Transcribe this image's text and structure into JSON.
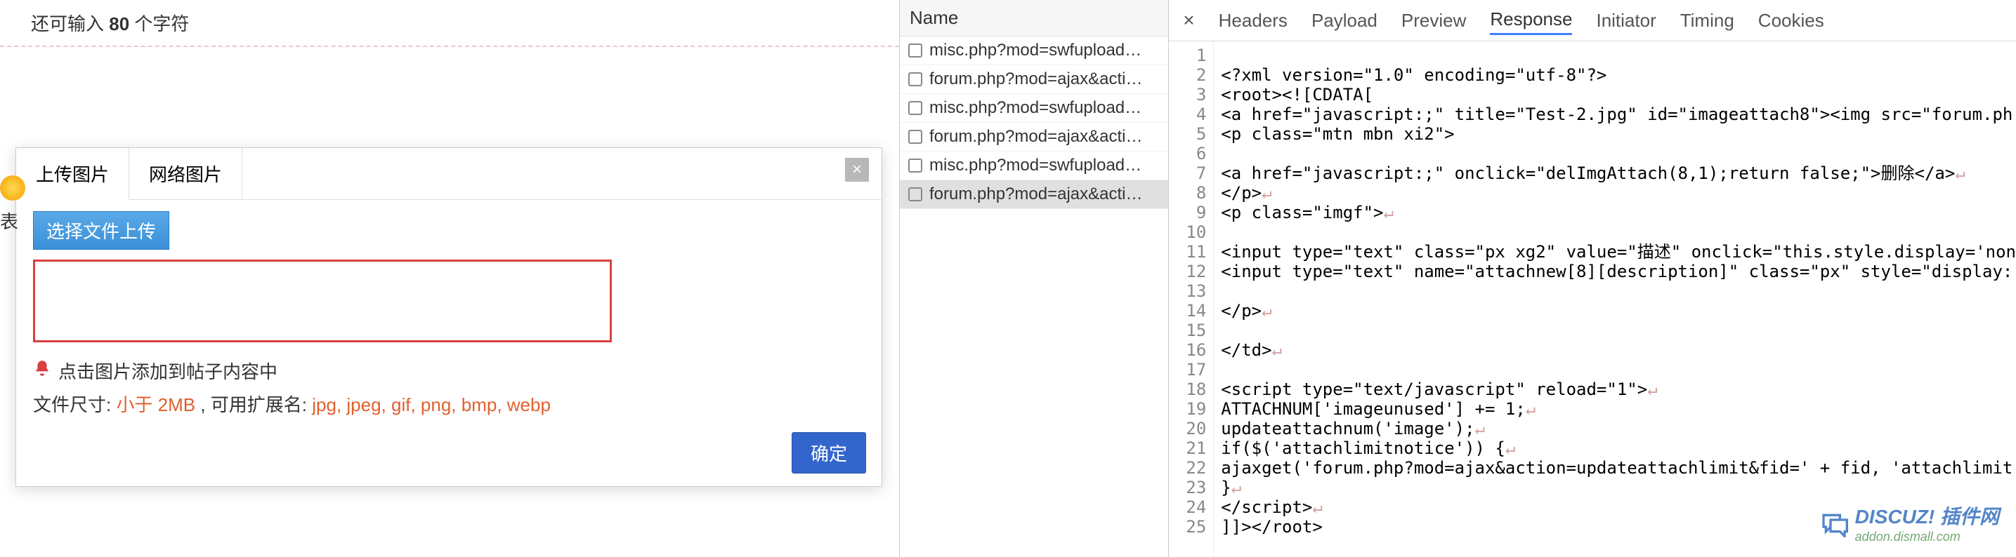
{
  "editor": {
    "char_counter_prefix": "还可输入 ",
    "char_count": "80",
    "char_counter_suffix": " 个字符",
    "side_label": "表"
  },
  "dialog": {
    "tabs": [
      "上传图片",
      "网络图片"
    ],
    "close_label": "×",
    "select_button": "选择文件上传",
    "hint": "点击图片添加到帖子内容中",
    "file_size_label": "文件尺寸: ",
    "file_size_value": "小于 2MB",
    "ext_label": " , 可用扩展名: ",
    "ext_value": "jpg, jpeg, gif, png, bmp, webp",
    "confirm": "确定"
  },
  "devtools": {
    "name_header": "Name",
    "requests": [
      "misc.php?mod=swfupload…",
      "forum.php?mod=ajax&acti…",
      "misc.php?mod=swfupload…",
      "forum.php?mod=ajax&acti…",
      "misc.php?mod=swfupload…",
      "forum.php?mod=ajax&acti…"
    ],
    "selected_index": 5,
    "tabs": [
      "Headers",
      "Payload",
      "Preview",
      "Response",
      "Initiator",
      "Timing",
      "Cookies"
    ],
    "active_tab": "Response",
    "close_icon": "×",
    "code": [
      "",
      "<?xml version=\"1.0\" encoding=\"utf-8\"?>",
      "<root><![CDATA[",
      "<a href=\"javascript:;\" title=\"Test-2.jpg\" id=\"imageattach8\"><img src=\"forum.ph",
      "<p class=\"mtn mbn xi2\">",
      "",
      "<a href=\"javascript:;\" onclick=\"delImgAttach(8,1);return false;\">删除</a>↵",
      "</p>↵",
      "<p class=\"imgf\">↵",
      "",
      "<input type=\"text\" class=\"px xg2\" value=\"描述\" onclick=\"this.style.display='non",
      "<input type=\"text\" name=\"attachnew[8][description]\" class=\"px\" style=\"display:",
      "",
      "</p>↵",
      "",
      "</td>↵",
      "",
      "<script type=\"text/javascript\" reload=\"1\">↵",
      "ATTACHNUM['imageunused'] += 1;↵",
      "updateattachnum('image');↵",
      "if($('attachlimitnotice')) {↵",
      "ajaxget('forum.php?mod=ajax&action=updateattachlimit&fid=' + fid, 'attachlimit",
      "}↵",
      "</script>↵",
      "]]></root>"
    ]
  },
  "watermark": {
    "title": "DISCUZ! 插件网",
    "url": "addon.dismall.com"
  }
}
